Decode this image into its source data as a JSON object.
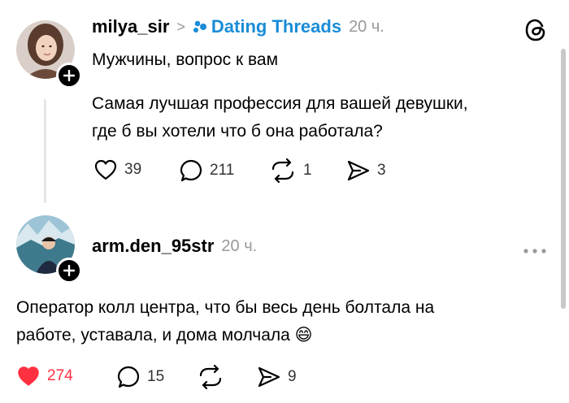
{
  "post": {
    "author": "milya_sir",
    "separator": ">",
    "community": "Dating Threads",
    "time": "20 ч.",
    "title": "Мужчины, вопрос к вам",
    "body_line1": "Самая лучшая профессия для вашей девушки,",
    "body_line2": "где б вы хотели что б она работала?",
    "likes": "39",
    "replies": "211",
    "reposts": "1",
    "shares": "3"
  },
  "reply": {
    "author": "arm.den_95str",
    "time": "20 ч.",
    "body_line1": "Оператор колл центра, что бы весь день болтала на",
    "body_line2": "работе, уставала, и дома молчала 😄",
    "likes": "274",
    "replies": "15",
    "shares": "9"
  },
  "colors": {
    "link": "#1a8cd8",
    "like_active": "#ff3040",
    "muted": "#999999"
  },
  "icons": {
    "app": "threads-logo-icon",
    "more": "more-options-icon"
  }
}
